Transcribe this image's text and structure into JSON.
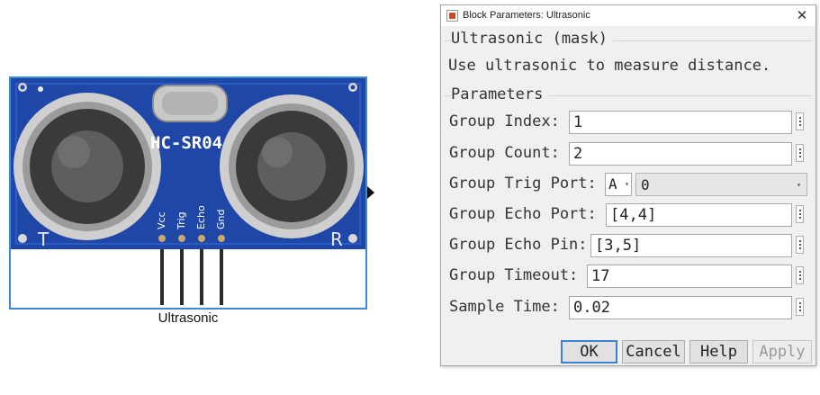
{
  "block": {
    "name": "Ultrasonic",
    "module_label": "HC-SR04",
    "pins": [
      "Vcc",
      "Trig",
      "Echo",
      "Gnd"
    ],
    "corner_left": "T",
    "corner_right": "R"
  },
  "dialog": {
    "title": "Block Parameters: Ultrasonic",
    "close_glyph": "✕",
    "mask_title": "Ultrasonic (mask)",
    "description": "Use ultrasonic to measure distance.",
    "parameters_title": "Parameters",
    "fields": {
      "group_index": {
        "label": "Group Index:",
        "value": "1"
      },
      "group_count": {
        "label": "Group Count:",
        "value": "2"
      },
      "group_trig_port": {
        "label": "Group Trig Port:",
        "port_letter": "A",
        "port_value": "0"
      },
      "group_echo_port": {
        "label": "Group Echo Port:",
        "value": "[4,4]"
      },
      "group_echo_pin": {
        "label": "Group Echo Pin:",
        "value": "[3,5]"
      },
      "group_timeout": {
        "label": "Group Timeout:",
        "value": "17"
      },
      "sample_time": {
        "label": "Sample Time:",
        "value": "0.02"
      }
    },
    "buttons": {
      "ok": "OK",
      "cancel": "Cancel",
      "help": "Help",
      "apply": "Apply"
    }
  }
}
